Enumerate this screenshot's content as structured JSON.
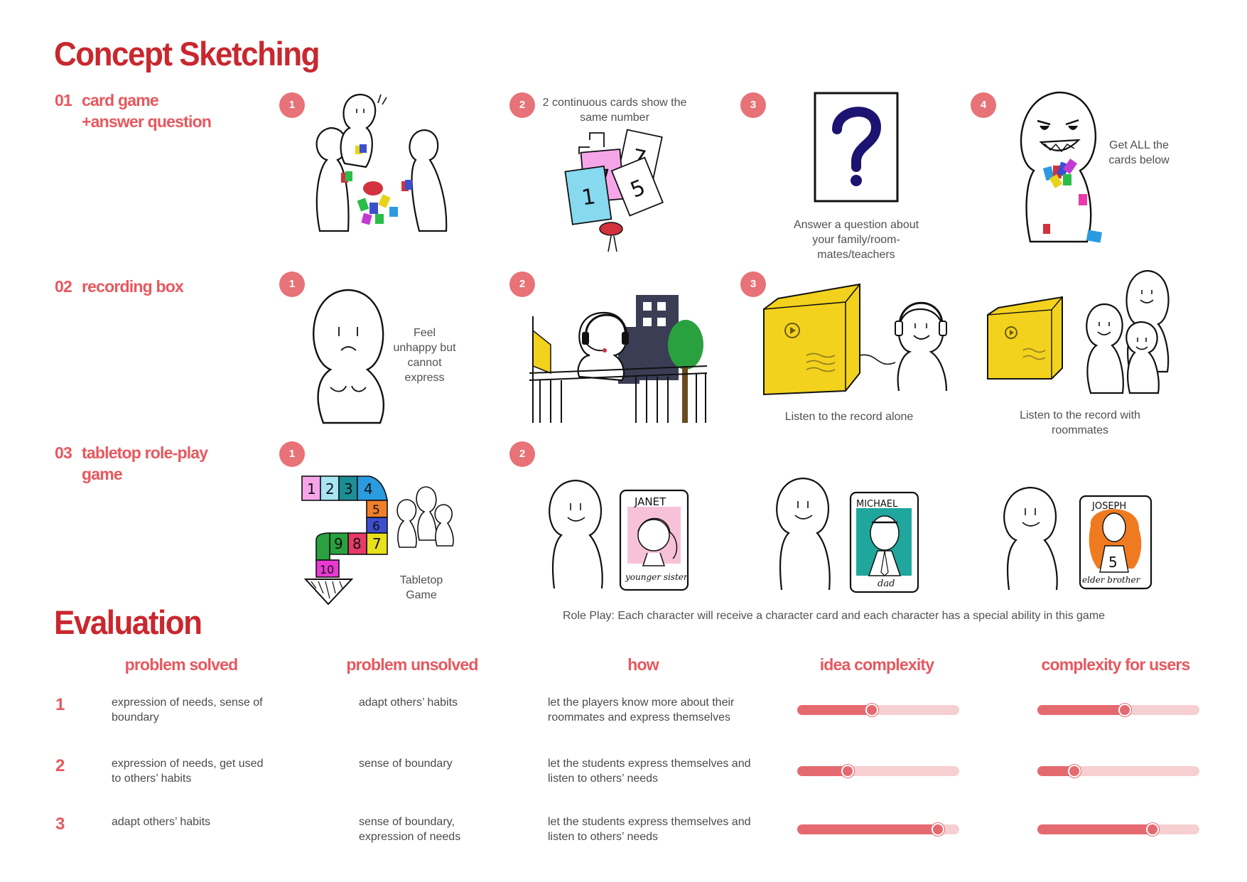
{
  "concept": {
    "title": "Concept Sketching",
    "sections": [
      {
        "num": "01",
        "line1": "card game",
        "line2": "+answer question"
      },
      {
        "num": "02",
        "line1": "recording box",
        "line2": ""
      },
      {
        "num": "03",
        "line1": "tabletop role-play",
        "line2": "game"
      }
    ],
    "card_steps": {
      "b1": "1",
      "b2": "2",
      "b3": "3",
      "b4": "4",
      "cap2": "2 continuous cards show the same number",
      "cap3": "Answer a question about your family/room-mates/teachers",
      "cap4": "Get ALL the cards below",
      "card_numbers": [
        "1",
        "7",
        "5",
        "7"
      ]
    },
    "recording_steps": {
      "b1": "1",
      "b2": "2",
      "b3": "3",
      "cap1": "Feel unhappy but cannot express",
      "cap3": "Listen to the record alone",
      "cap4": "Listen to the record with roommates"
    },
    "roleplay_steps": {
      "b1": "1",
      "b2": "2",
      "board_numbers": [
        "1",
        "2",
        "3",
        "4",
        "5",
        "6",
        "7",
        "8",
        "9",
        "10"
      ],
      "cap1": "Tabletop Game",
      "cards": [
        {
          "name": "JANET",
          "role": "younger sister"
        },
        {
          "name": "MICHAEL",
          "role": "dad"
        },
        {
          "name": "JOSEPH",
          "role": "elder brother"
        }
      ],
      "joseph_number": "5",
      "cap2": "Role Play: Each character will receive a character card and each character has a special ability in this game"
    }
  },
  "evaluation": {
    "title": "Evaluation",
    "headers": {
      "solved": "problem solved",
      "unsolved": "problem unsolved",
      "how": "how",
      "idea": "idea complexity",
      "users": "complexity for users"
    },
    "rows": [
      {
        "num": "1",
        "solved": "expression of needs, sense of boundary",
        "unsolved": "adapt others’ habits",
        "how": "let the players know more about their roommates and express themselves",
        "idea": 0.46,
        "users": 0.54
      },
      {
        "num": "2",
        "solved": "expression of needs, get used to others’ habits",
        "unsolved": "sense of boundary",
        "how": "let the students express themselves and listen to others’ needs",
        "idea": 0.31,
        "users": 0.23
      },
      {
        "num": "3",
        "solved": "adapt others’ habits",
        "unsolved": "sense of boundary, expression of needs",
        "how": "let the students express themselves and listen to others’ needs",
        "idea": 0.87,
        "users": 0.71
      }
    ]
  },
  "colors": {
    "title_red": "#c8282e",
    "label_red": "#e7585e",
    "badge": "#e77277",
    "slider_fill": "#e56a70",
    "slider_track": "#f6cfd1",
    "box_yellow": "#f3d21d"
  }
}
